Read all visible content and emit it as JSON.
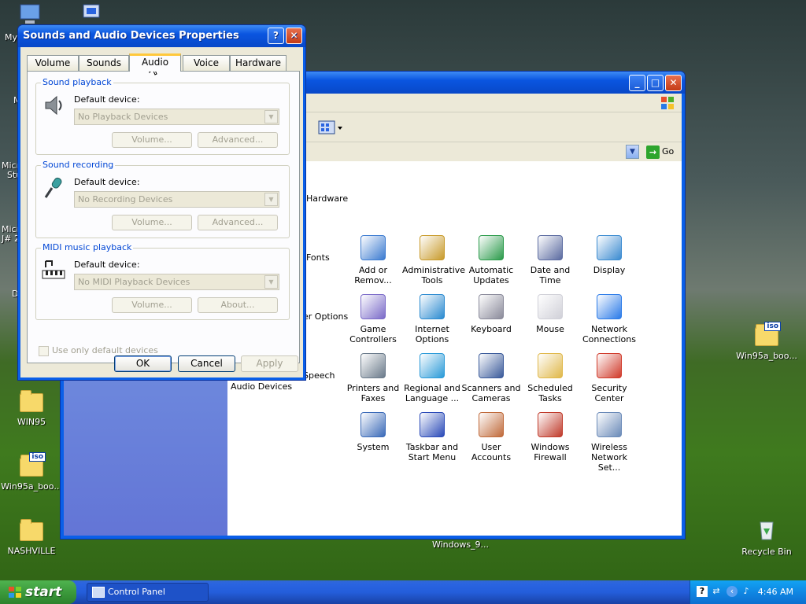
{
  "desktop_icons": [
    {
      "label": "My"
    },
    {
      "label": "WIN95"
    },
    {
      "label": "Win95a_boo..."
    },
    {
      "label": "NASHVILLE"
    },
    {
      "label": "Win95a_boo..."
    },
    {
      "label": "Recycle Bin"
    },
    {
      "label": "Windows_9..."
    }
  ],
  "desktop_partials": [
    "M",
    "Micr",
    "Stu",
    "Micr",
    "J# 2",
    "D"
  ],
  "control_panel": {
    "go_label": "Go",
    "partial_labels": {
      "hardware": "Hardware",
      "fonts": "Fonts",
      "user_options": "er Options",
      "speech": "Speech",
      "audio_devices": "Audio Devices"
    },
    "items": [
      {
        "label1": "Add or",
        "label2": "Remov...",
        "icon": "add-remove-programs-icon"
      },
      {
        "label1": "Administrative",
        "label2": "Tools",
        "icon": "admin-tools-icon"
      },
      {
        "label1": "Automatic",
        "label2": "Updates",
        "icon": "automatic-updates-icon"
      },
      {
        "label1": "Date and Time",
        "label2": "",
        "icon": "date-time-icon"
      },
      {
        "label1": "Display",
        "label2": "",
        "icon": "display-icon"
      },
      {
        "label1": "Game",
        "label2": "Controllers",
        "icon": "game-controllers-icon"
      },
      {
        "label1": "Internet",
        "label2": "Options",
        "icon": "internet-options-icon"
      },
      {
        "label1": "Keyboard",
        "label2": "",
        "icon": "keyboard-icon"
      },
      {
        "label1": "Mouse",
        "label2": "",
        "icon": "mouse-icon"
      },
      {
        "label1": "Network",
        "label2": "Connections",
        "icon": "network-connections-icon"
      },
      {
        "label1": "Printers and",
        "label2": "Faxes",
        "icon": "printers-faxes-icon"
      },
      {
        "label1": "Regional and",
        "label2": "Language ...",
        "icon": "regional-language-icon"
      },
      {
        "label1": "Scanners and",
        "label2": "Cameras",
        "icon": "scanners-cameras-icon"
      },
      {
        "label1": "Scheduled",
        "label2": "Tasks",
        "icon": "scheduled-tasks-icon"
      },
      {
        "label1": "Security",
        "label2": "Center",
        "icon": "security-center-icon"
      },
      {
        "label1": "System",
        "label2": "",
        "icon": "system-icon"
      },
      {
        "label1": "Taskbar and",
        "label2": "Start Menu",
        "icon": "taskbar-start-menu-icon"
      },
      {
        "label1": "User Accounts",
        "label2": "",
        "icon": "user-accounts-icon"
      },
      {
        "label1": "Windows",
        "label2": "Firewall",
        "icon": "windows-firewall-icon"
      },
      {
        "label1": "Wireless",
        "label2": "Network Set...",
        "icon": "wireless-network-icon"
      }
    ]
  },
  "dialog": {
    "title": "Sounds and Audio Devices Properties",
    "tabs": [
      "Volume",
      "Sounds",
      "Audio",
      "Voice",
      "Hardware"
    ],
    "active_tab": "Audio",
    "groups": [
      {
        "label": "Sound playback",
        "default_label": "Default device:",
        "combo": "No Playback Devices",
        "btn1": "Volume...",
        "btn2": "Advanced..."
      },
      {
        "label": "Sound recording",
        "default_label": "Default device:",
        "combo": "No Recording Devices",
        "btn1": "Volume...",
        "btn2": "Advanced..."
      },
      {
        "label": "MIDI music playback",
        "default_label": "Default device:",
        "combo": "No MIDI Playback Devices",
        "btn1": "Volume...",
        "btn2": "About..."
      }
    ],
    "checkbox": "Use only default devices",
    "ok": "OK",
    "cancel": "Cancel",
    "apply": "Apply"
  },
  "taskbar": {
    "start": "start",
    "task": "Control Panel",
    "clock": "4:46 AM"
  }
}
